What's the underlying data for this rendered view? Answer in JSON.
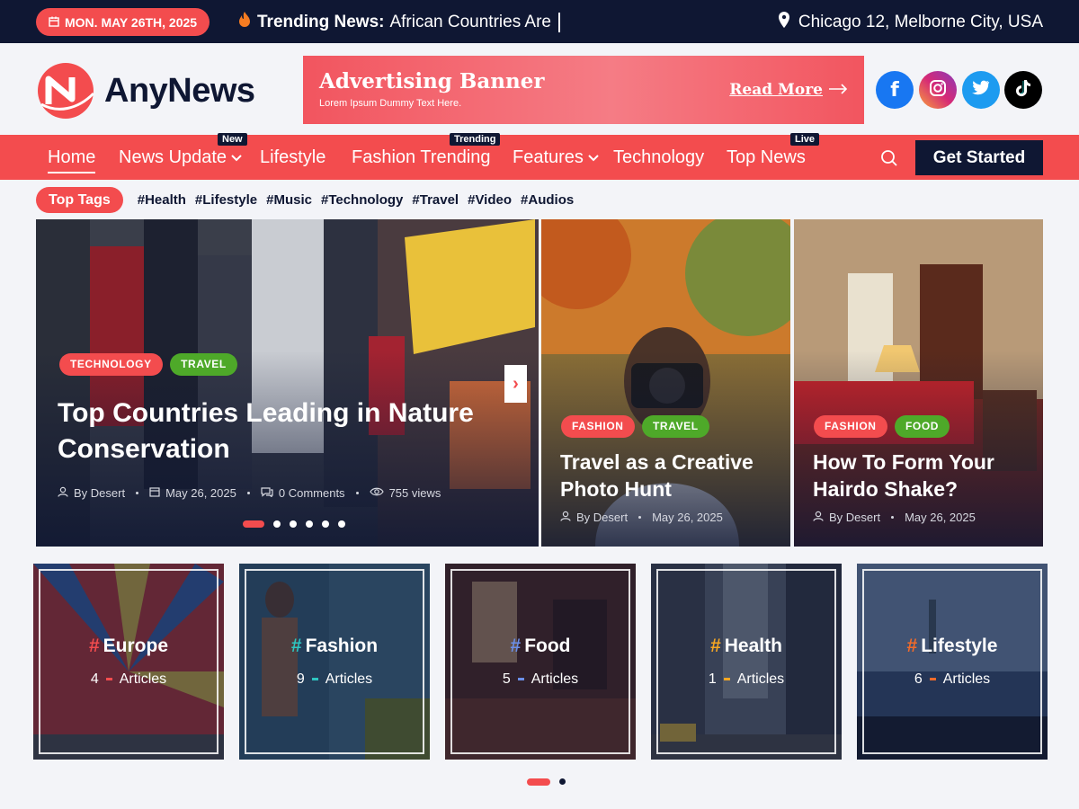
{
  "topbar": {
    "date": "MON. MAY 26TH, 2025",
    "trending_label": "Trending News:",
    "trending_text": "African Countries Are",
    "location": "Chicago 12, Melborne City, USA"
  },
  "brand": {
    "name": "AnyNews"
  },
  "ad": {
    "title": "Advertising Banner",
    "subtitle": "Lorem Ipsum Dummy Text Here.",
    "link": "Read More"
  },
  "social": [
    {
      "name": "facebook-icon",
      "color": "#1877f2",
      "glyph": "f"
    },
    {
      "name": "instagram-icon",
      "color": "#d62976",
      "glyph": "◎"
    },
    {
      "name": "twitter-icon",
      "color": "#1d9bf0",
      "glyph": "✦"
    },
    {
      "name": "tiktok-icon",
      "color": "#000000",
      "glyph": "♪"
    }
  ],
  "nav": {
    "items": [
      {
        "label": "Home"
      },
      {
        "label": "News Update",
        "badge": "New"
      },
      {
        "label": "Lifestyle"
      },
      {
        "label": "Fashion Trending",
        "badge": "Trending"
      },
      {
        "label": "Features"
      },
      {
        "label": "Technology"
      },
      {
        "label": "Top News",
        "badge": "Live"
      }
    ],
    "cta": "Get Started"
  },
  "tags": {
    "label": "Top Tags",
    "items": [
      "#Health",
      "#Lifestyle",
      "#Music",
      "#Technology",
      "#Travel",
      "#Video",
      "#Audios"
    ]
  },
  "hero": {
    "main": {
      "chips": [
        "TECHNOLOGY",
        "TRAVEL"
      ],
      "title": "Top Countries Leading in Nature Conservation",
      "author": "By Desert",
      "date": "May 26, 2025",
      "comments": "0 Comments",
      "views": "755 views"
    },
    "side": [
      {
        "chips": [
          "FASHION",
          "TRAVEL"
        ],
        "title": "Travel as a Creative Photo Hunt",
        "author": "By Desert",
        "date": "May 26, 2025"
      },
      {
        "chips": [
          "FASHION",
          "FOOD"
        ],
        "title": "How To Form Your Hairdo Shake?",
        "author": "By Desert",
        "date": "May 26, 2025"
      }
    ]
  },
  "categories": [
    {
      "name": "Europe",
      "count": "4",
      "unit": "Articles",
      "accent": "#f34c4e"
    },
    {
      "name": "Fashion",
      "count": "9",
      "unit": "Articles",
      "accent": "#2ec5c0"
    },
    {
      "name": "Food",
      "count": "5",
      "unit": "Articles",
      "accent": "#6b8fe8"
    },
    {
      "name": "Health",
      "count": "1",
      "unit": "Articles",
      "accent": "#f5a623"
    },
    {
      "name": "Lifestyle",
      "count": "6",
      "unit": "Articles",
      "accent": "#f26b2a"
    }
  ],
  "colors": {
    "brand_red": "#f34c4e",
    "navy": "#0f1733",
    "green": "#4ea929"
  }
}
